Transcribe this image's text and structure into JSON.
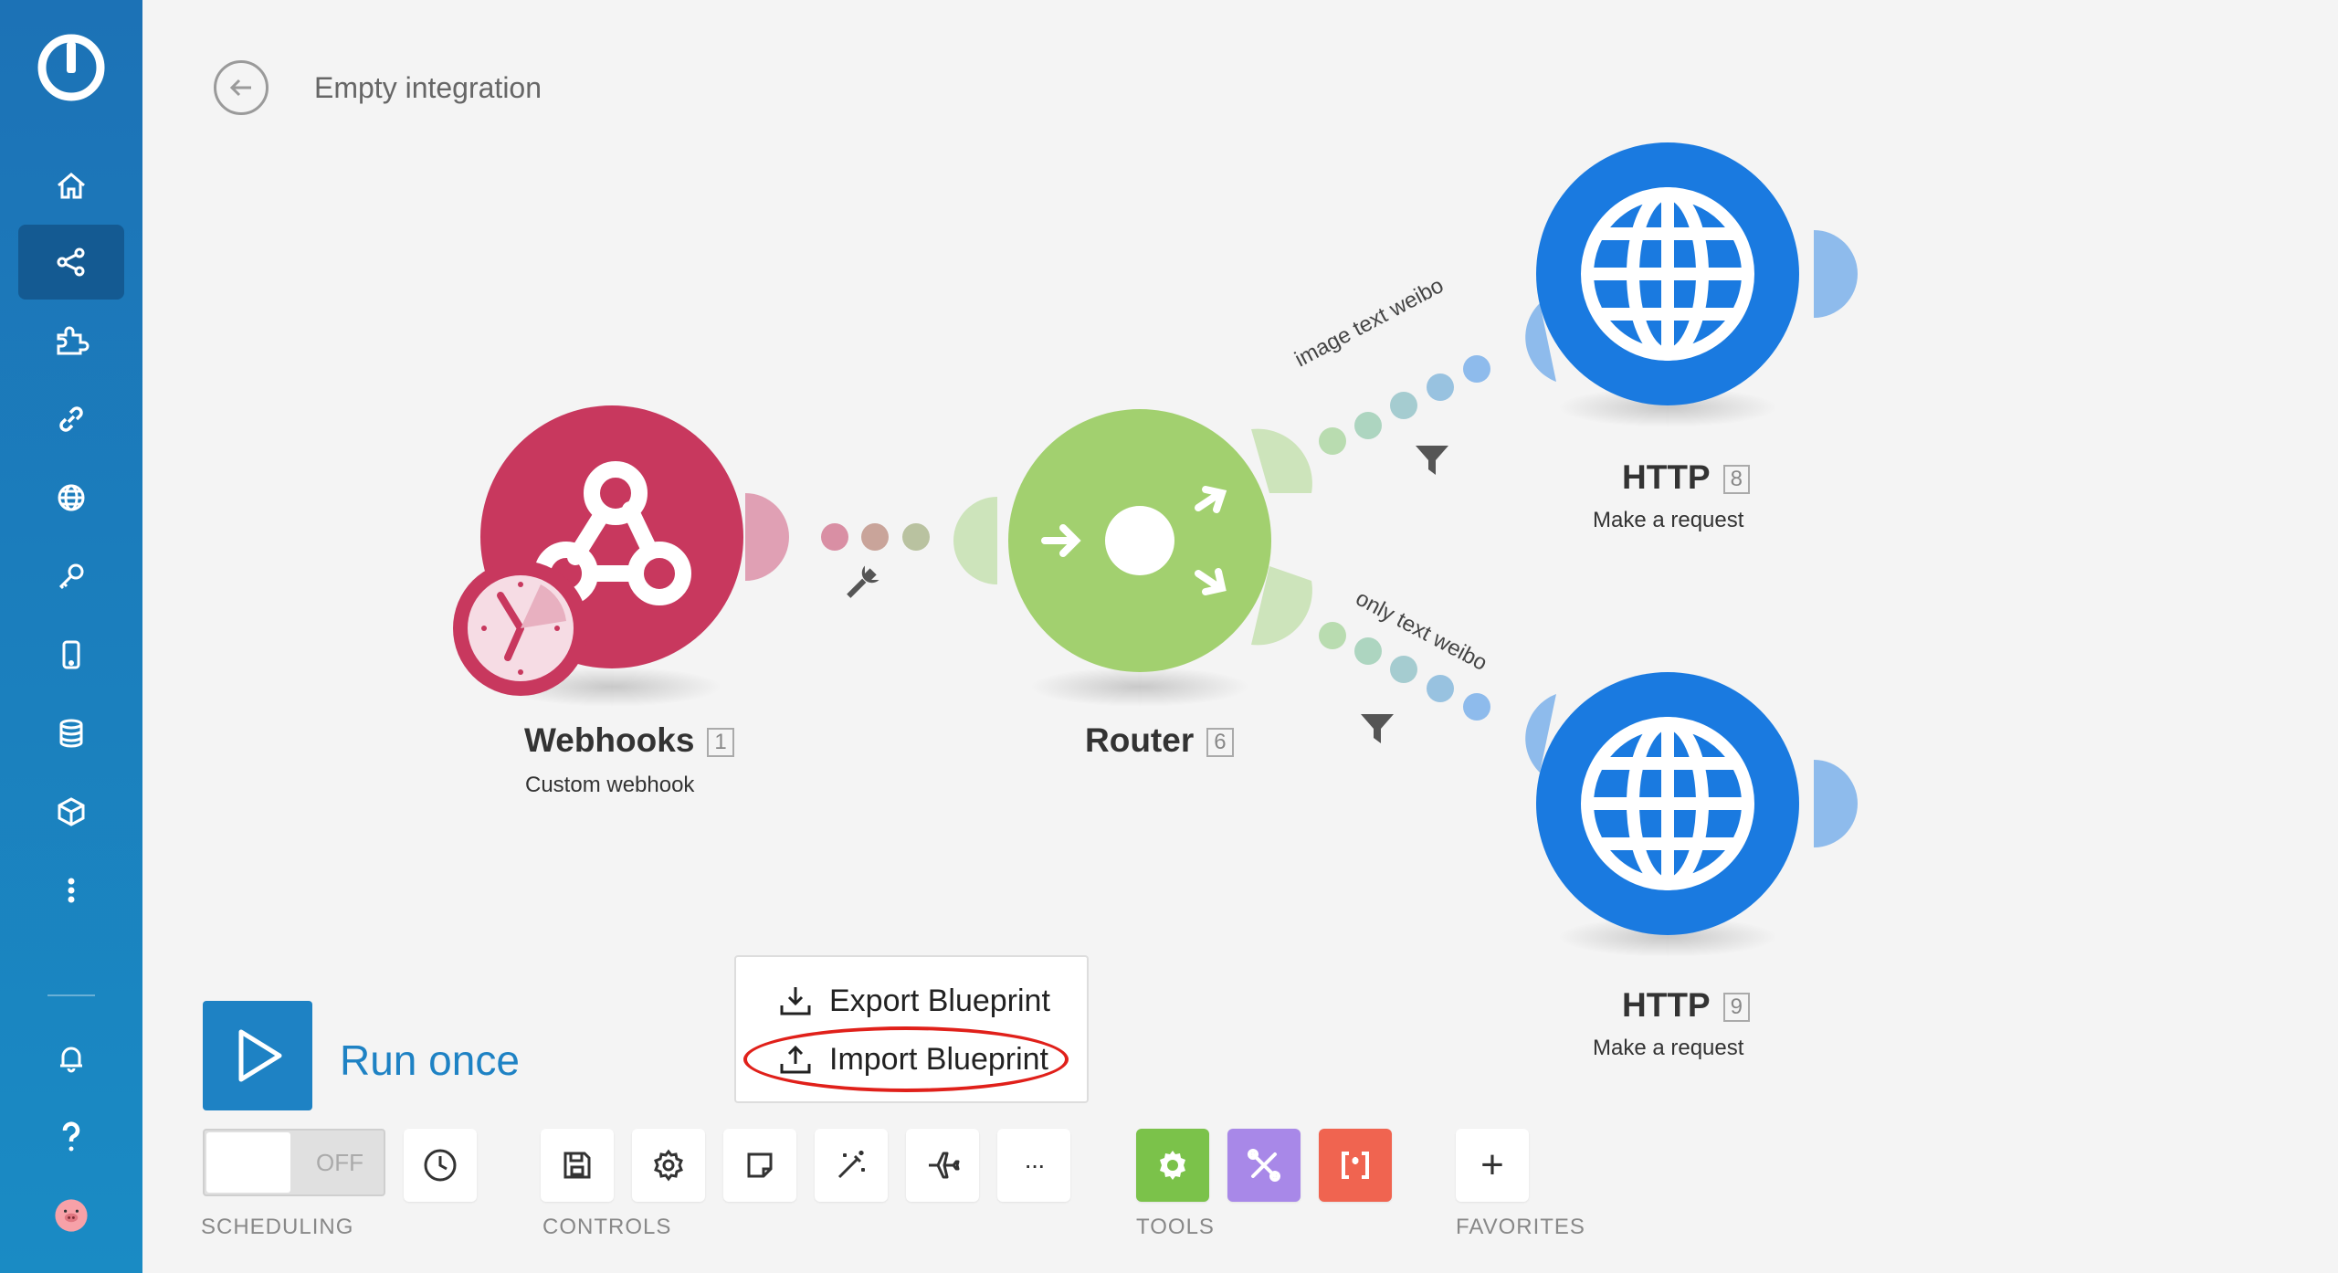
{
  "app": {
    "title": "Empty integration"
  },
  "sidebar": {
    "items": [
      {
        "icon": "home-icon"
      },
      {
        "icon": "share-icon",
        "active": true
      },
      {
        "icon": "puzzle-icon"
      },
      {
        "icon": "link-icon"
      },
      {
        "icon": "globe-icon"
      },
      {
        "icon": "key-icon"
      },
      {
        "icon": "mobile-icon"
      },
      {
        "icon": "database-icon"
      },
      {
        "icon": "cube-icon"
      },
      {
        "icon": "more-vertical-icon"
      },
      {
        "icon": "bell-icon"
      },
      {
        "icon": "help-icon"
      },
      {
        "icon": "avatar"
      }
    ]
  },
  "modules": {
    "webhooks": {
      "name": "Webhooks",
      "num": "1",
      "sub": "Custom webhook",
      "color": "#c8385e"
    },
    "router": {
      "name": "Router",
      "num": "6",
      "color": "#a2d06f"
    },
    "http8": {
      "name": "HTTP",
      "num": "8",
      "sub": "Make a request",
      "color": "#1a7ae0"
    },
    "http9": {
      "name": "HTTP",
      "num": "9",
      "sub": "Make a request",
      "color": "#1a7ae0"
    }
  },
  "routes": {
    "upper": "image text weibo",
    "lower": "only text weibo"
  },
  "run": {
    "label": "Run once"
  },
  "scheduling": {
    "toggle_state": "OFF",
    "section_label": "SCHEDULING"
  },
  "controls": {
    "section_label": "CONTROLS",
    "buttons": [
      "save-icon",
      "settings-icon",
      "note-icon",
      "magic-wand-icon",
      "airplane-icon",
      "more-icon"
    ],
    "more_label": "···"
  },
  "tools": {
    "section_label": "TOOLS",
    "buttons": [
      {
        "icon": "gear-icon",
        "color": "#7bc24a"
      },
      {
        "icon": "tools-icon",
        "color": "#a888e8"
      },
      {
        "icon": "brackets-icon",
        "color": "#f06450"
      }
    ]
  },
  "favorites": {
    "section_label": "FAVORITES",
    "add_label": "+"
  },
  "blueprint_menu": {
    "export_label": "Export Blueprint",
    "import_label": "Import Blueprint"
  },
  "annotation": {
    "color": "#e0201a"
  }
}
